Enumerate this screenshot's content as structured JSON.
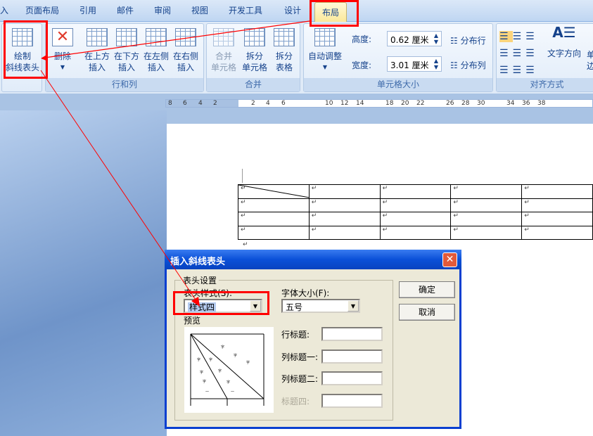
{
  "tabs": [
    "入",
    "页面布局",
    "引用",
    "邮件",
    "审阅",
    "视图",
    "开发工具",
    "设计",
    "布局"
  ],
  "active_tab": "布局",
  "ribbon": {
    "draw_table": {
      "line1": "绘制",
      "line2": "斜线表头"
    },
    "rows_cols": {
      "label": "行和列",
      "delete": "删除",
      "above": [
        "在上方",
        "插入"
      ],
      "below": [
        "在下方",
        "插入"
      ],
      "left": [
        "在左侧",
        "插入"
      ],
      "right": [
        "在右侧",
        "插入"
      ]
    },
    "merge": {
      "label": "合并",
      "merge_cells": [
        "合并",
        "单元格"
      ],
      "split_cells": [
        "拆分",
        "单元格"
      ],
      "split_table": [
        "拆分",
        "表格"
      ]
    },
    "cell_size": {
      "label": "单元格大小",
      "autofit": "自动调整",
      "height_label": "高度:",
      "height_value": "0.62 厘米",
      "width_label": "宽度:",
      "width_value": "3.01 厘米",
      "dist_rows": "分布行",
      "dist_cols": "分布列"
    },
    "align": {
      "label": "对齐方式",
      "text_dir": "文字方向",
      "margins": [
        "单",
        "边"
      ]
    }
  },
  "ruler": [
    "8",
    "6",
    "4",
    "2",
    "2",
    "4",
    "6",
    "10",
    "12",
    "14",
    "18",
    "20",
    "22",
    "26",
    "28",
    "30",
    "34",
    "36",
    "38"
  ],
  "doc": {
    "mark": "↵",
    "rows": 4,
    "cols": 5
  },
  "dialog": {
    "title": "插入斜线表头",
    "group": "表头设置",
    "style_label": "表头样式(S):",
    "style_value": "样式四",
    "font_label": "字体大小(F):",
    "font_value": "五号",
    "preview": "预览",
    "row_title": "行标题:",
    "col_title1": "列标题一:",
    "col_title2": "列标题二:",
    "title4": "标题四:",
    "ok": "确定",
    "cancel": "取消"
  },
  "colors": {
    "annotation": "#ff0000",
    "dialog_title": "#0a50d8",
    "active_tab": "#fbe89a"
  }
}
